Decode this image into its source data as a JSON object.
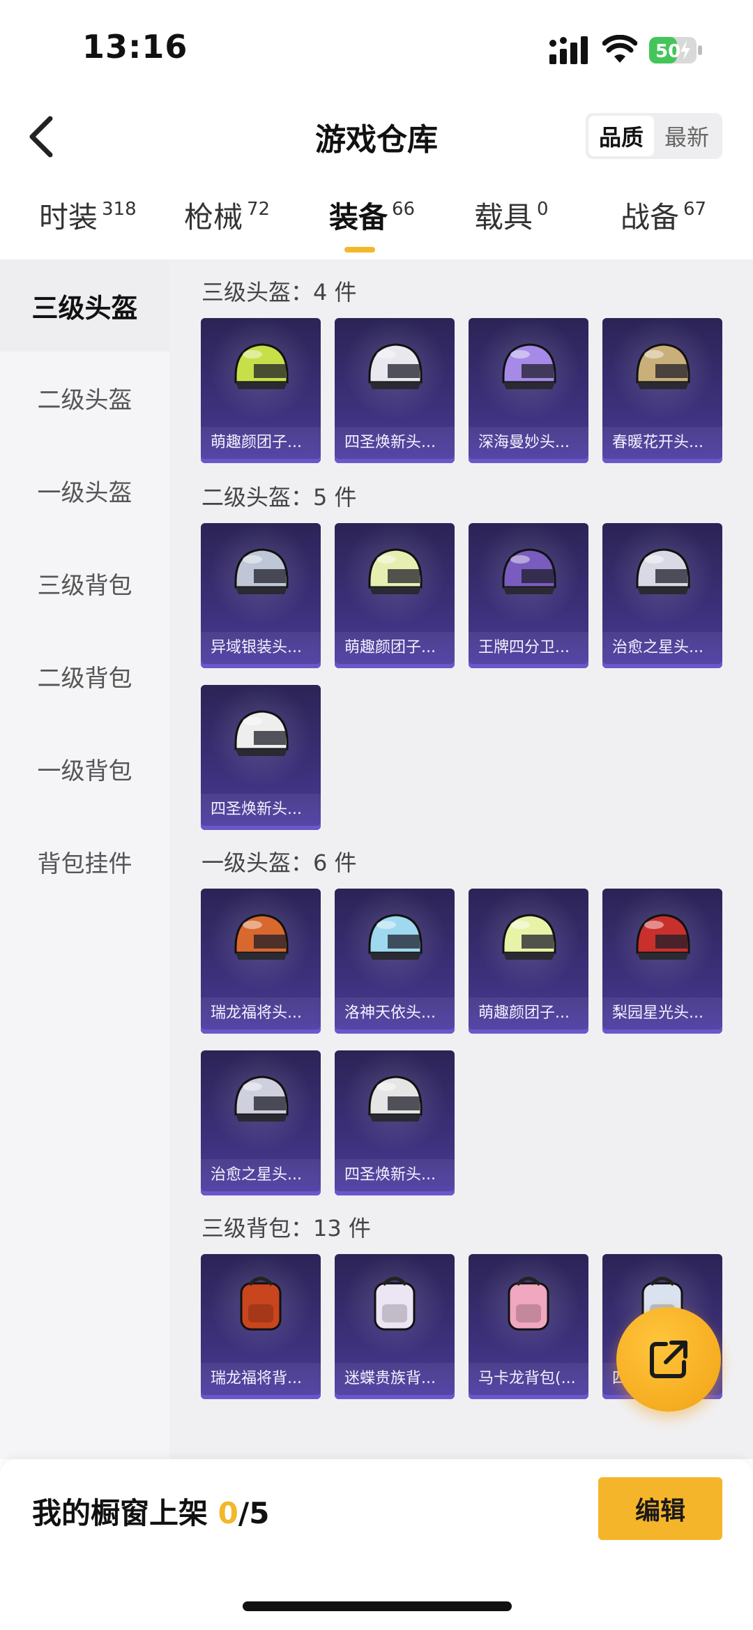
{
  "status_bar": {
    "time": "13:16",
    "battery": "50"
  },
  "header": {
    "title": "游戏仓库",
    "sort_options": [
      "品质",
      "最新"
    ],
    "active_sort": "品质"
  },
  "category_tabs": [
    {
      "label": "时装",
      "count": "318"
    },
    {
      "label": "枪械",
      "count": "72"
    },
    {
      "label": "装备",
      "count": "66"
    },
    {
      "label": "载具",
      "count": "0"
    },
    {
      "label": "战备",
      "count": "67"
    }
  ],
  "active_tab": "装备",
  "sidebar": {
    "items": [
      "三级头盔",
      "二级头盔",
      "一级头盔",
      "三级背包",
      "二级背包",
      "一级背包",
      "背包挂件"
    ],
    "active": "三级头盔"
  },
  "sections": [
    {
      "title": "三级头盔：4 件",
      "items": [
        {
          "name": "萌趣颜团子...",
          "icon": "helmet-green-icon",
          "color": "#c7e04a"
        },
        {
          "name": "四圣焕新头...",
          "icon": "helmet-white-icon",
          "color": "#e8e8ee"
        },
        {
          "name": "深海曼妙头...",
          "icon": "helmet-crown-icon",
          "color": "#a68ae8"
        },
        {
          "name": "春暖花开头...",
          "icon": "helmet-floral-icon",
          "color": "#c9b07a"
        }
      ]
    },
    {
      "title": "二级头盔：5 件",
      "items": [
        {
          "name": "异域银装头...",
          "icon": "helmet-silver-icon",
          "color": "#bfc7d6"
        },
        {
          "name": "萌趣颜团子...",
          "icon": "helmet-green-icon",
          "color": "#e7efb0"
        },
        {
          "name": "王牌四分卫...",
          "icon": "helmet-football-icon",
          "color": "#7a5cc0"
        },
        {
          "name": "治愈之星头...",
          "icon": "helmet-star-icon",
          "color": "#d9d9e6"
        },
        {
          "name": "四圣焕新头...",
          "icon": "helmet-white-icon",
          "color": "#eeeeee"
        }
      ]
    },
    {
      "title": "一级头盔：6 件",
      "items": [
        {
          "name": "瑞龙福将头...",
          "icon": "helmet-orange-icon",
          "color": "#d9682e"
        },
        {
          "name": "洛神天依头...",
          "icon": "helmet-blue-icon",
          "color": "#9fd9ef"
        },
        {
          "name": "萌趣颜团子...",
          "icon": "helmet-green-icon",
          "color": "#e8f3a8"
        },
        {
          "name": "梨园星光头...",
          "icon": "helmet-red-icon",
          "color": "#c9302c"
        },
        {
          "name": "治愈之星头...",
          "icon": "helmet-star-icon",
          "color": "#cfd0de"
        },
        {
          "name": "四圣焕新头...",
          "icon": "helmet-white-icon",
          "color": "#e5e5e5"
        }
      ]
    },
    {
      "title": "三级背包：13 件",
      "items": [
        {
          "name": "瑞龙福将背...",
          "icon": "backpack-dragon-icon",
          "color": "#c8451e"
        },
        {
          "name": "迷蝶贵族背...",
          "icon": "backpack-butterfly-icon",
          "color": "#ece6f4"
        },
        {
          "name": "马卡龙背包(...",
          "icon": "backpack-pink-icon",
          "color": "#f0a7c0"
        },
        {
          "name": "四...",
          "icon": "backpack-mecha-icon",
          "color": "#dbe2ef"
        }
      ]
    }
  ],
  "bottom_bar": {
    "label": "我的橱窗上架 ",
    "used": "0",
    "total": "/5",
    "edit_label": "编辑"
  }
}
